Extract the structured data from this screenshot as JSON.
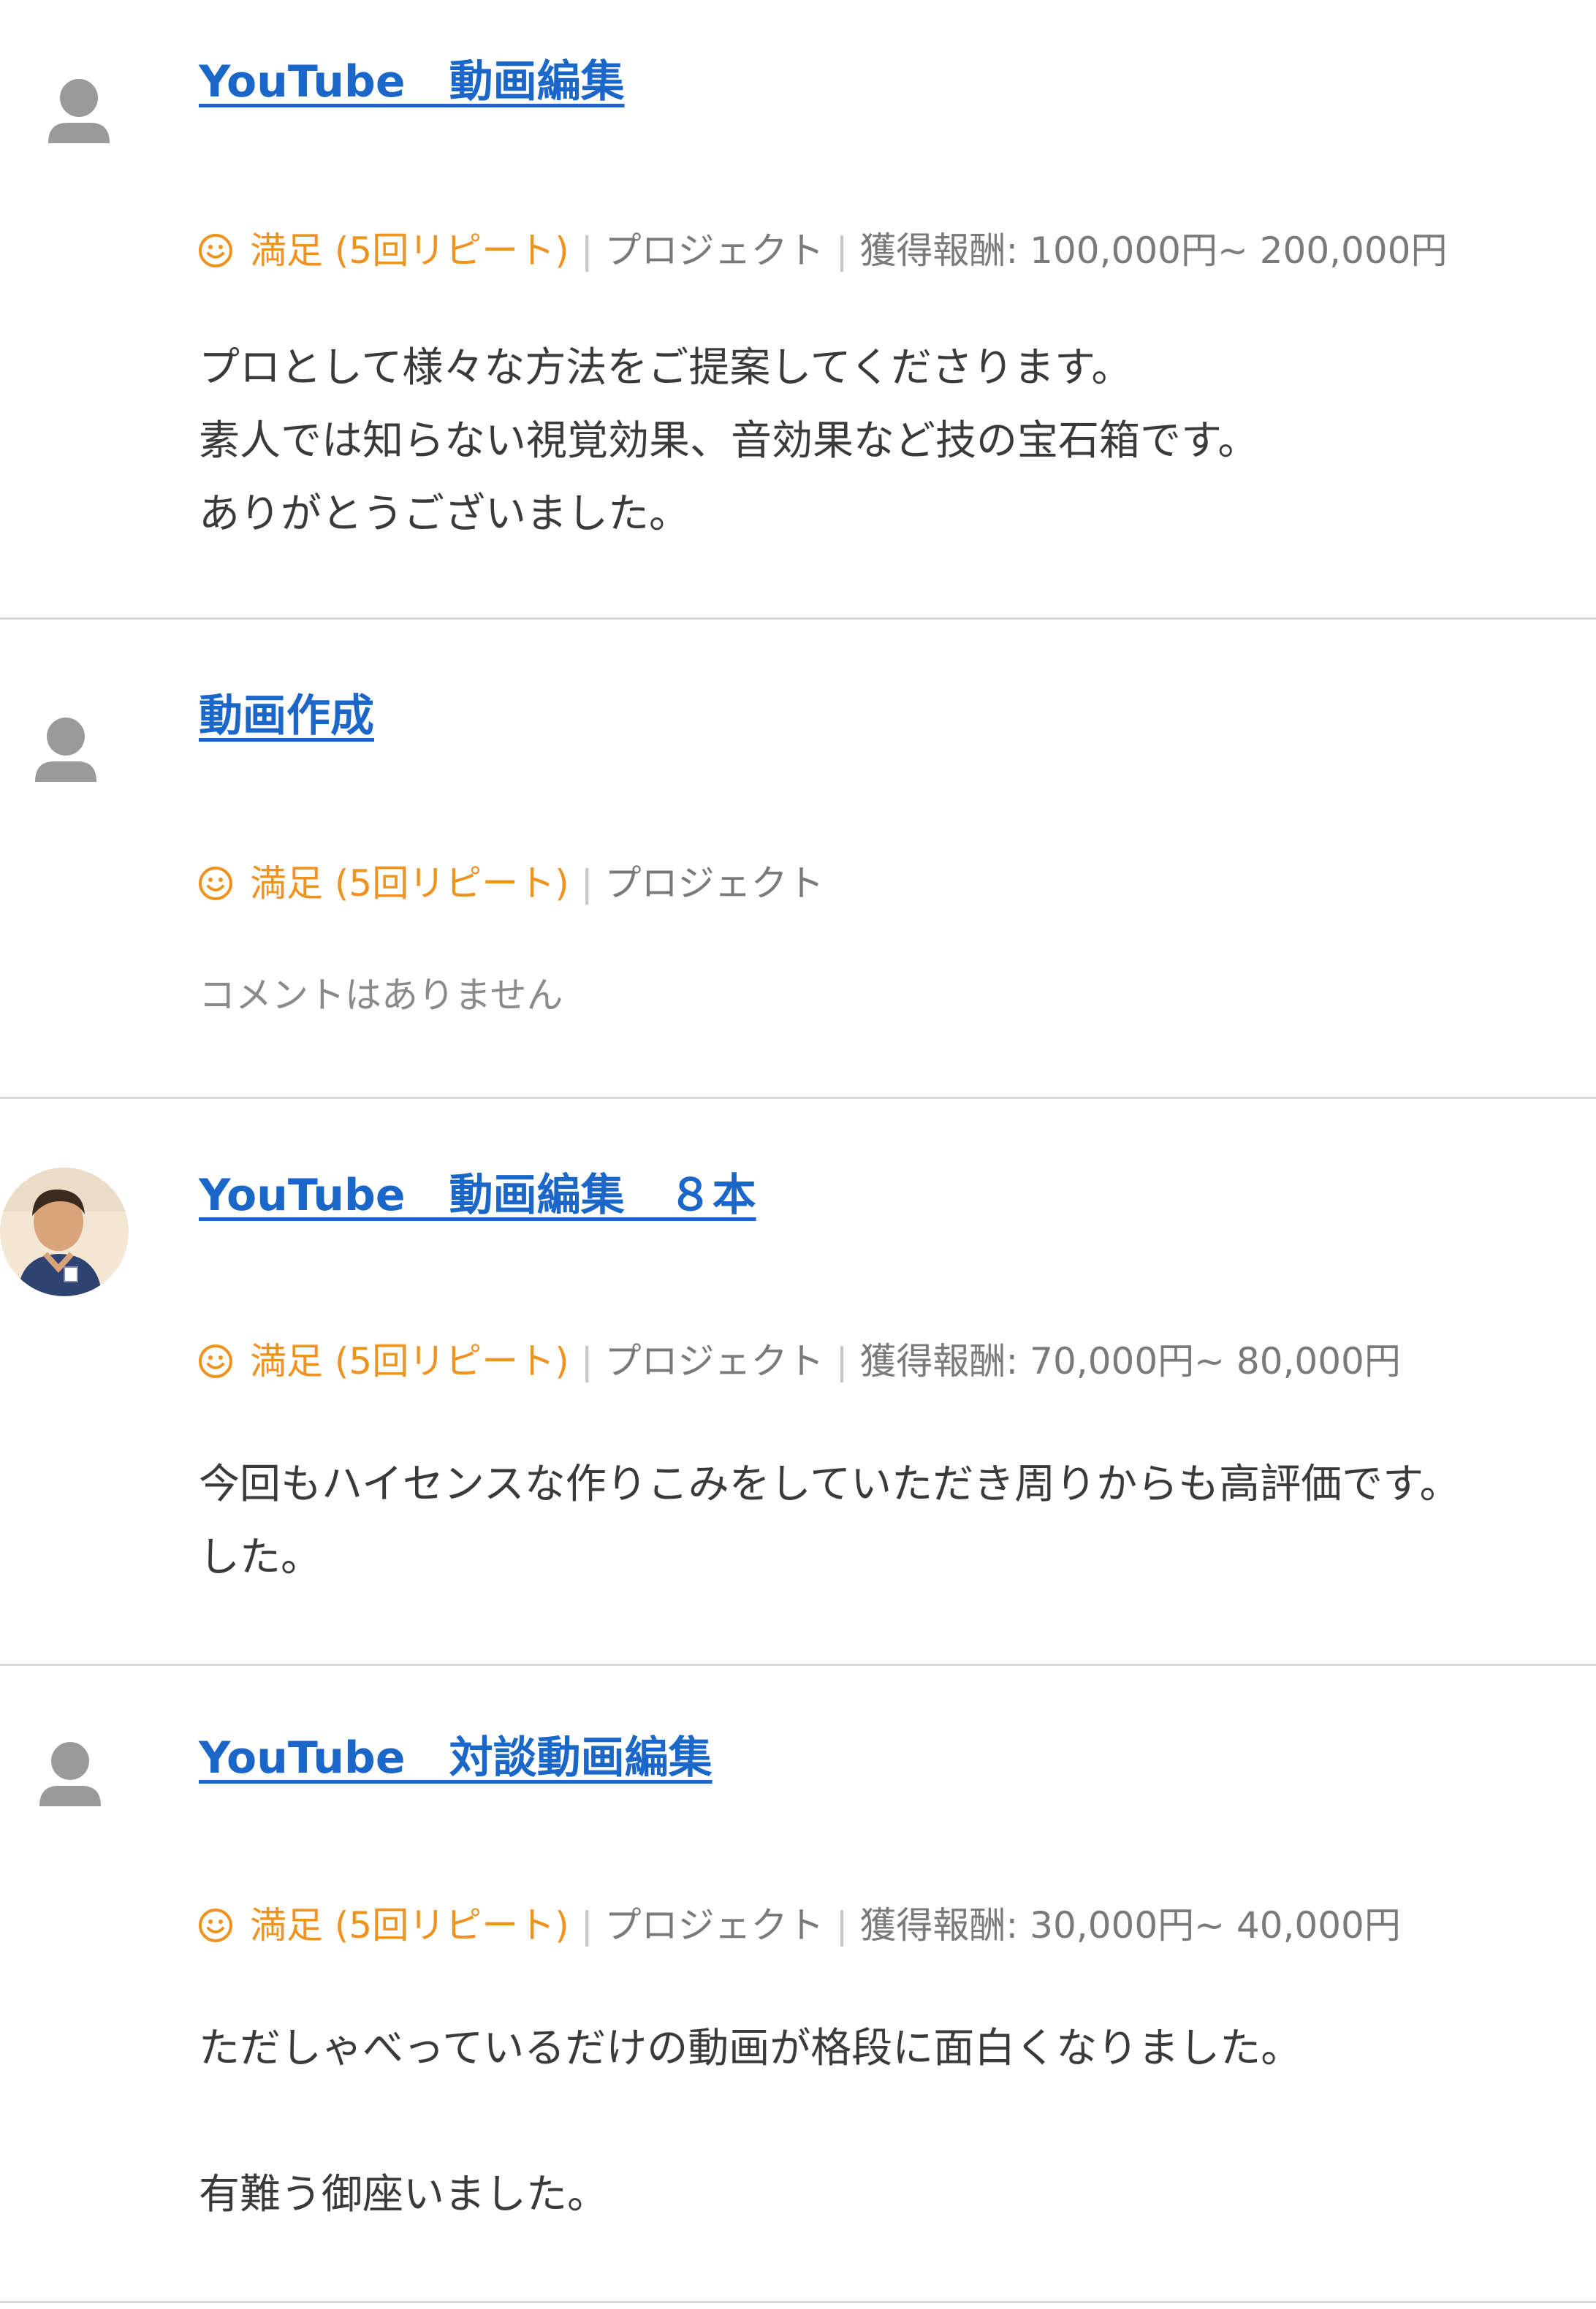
{
  "reviews": [
    {
      "title": "YouTube　動画編集",
      "rating_label": "満足 (5回リピート)",
      "type": "プロジェクト",
      "reward": "獲得報酬: 100,000円~ 200,000円",
      "comment_lines": [
        "プロとして様々な方法をご提案してくださります。",
        "素人では知らない視覚効果、音効果など技の宝石箱です。",
        "ありがとうございました。"
      ],
      "avatar": "default-user-icon"
    },
    {
      "title": "動画作成",
      "rating_label": "満足 (5回リピート)",
      "type": "プロジェクト",
      "reward": "",
      "comment_lines": [
        "コメントはありません"
      ],
      "avatar": "default-user-icon"
    },
    {
      "title": "YouTube　動画編集　８本",
      "rating_label": "満足 (5回リピート)",
      "type": "プロジェクト",
      "reward": "獲得報酬: 70,000円~ 80,000円",
      "comment_lines": [
        "今回もハイセンスな作りこみをしていただき周りからも高評価です。",
        "した。"
      ],
      "avatar": "user-photo"
    },
    {
      "title": "YouTube　対談動画編集",
      "rating_label": "満足 (5回リピート)",
      "type": "プロジェクト",
      "reward": "獲得報酬: 30,000円~ 40,000円",
      "comment_lines": [
        "ただしゃべっているだけの動画が格段に面白くなりました。",
        "",
        "有難う御座いました。"
      ],
      "avatar": "default-user-icon"
    }
  ],
  "colors": {
    "link": "#1a66c9",
    "rating": "#ee9320",
    "meta": "#7a7a7a",
    "divider": "#d9d9d9",
    "avatar_icon": "#9a9a9a"
  }
}
